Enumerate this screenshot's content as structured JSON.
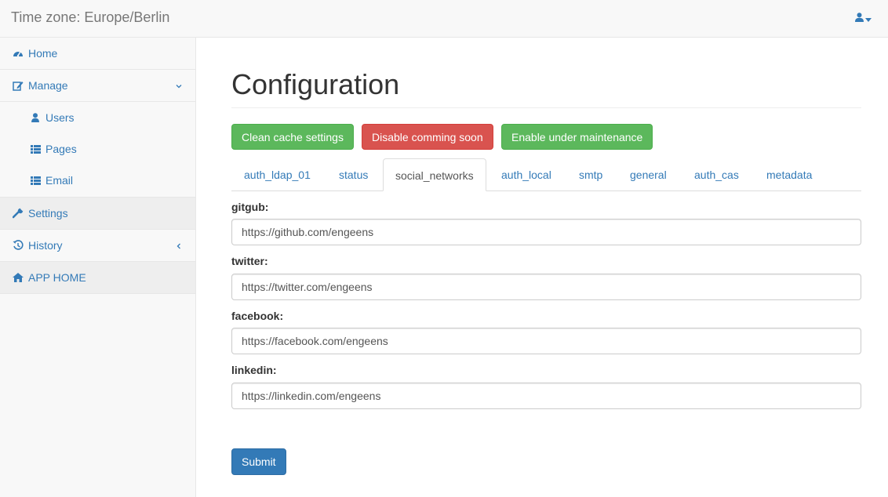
{
  "navbar": {
    "title": "Time zone: Europe/Berlin",
    "user_icon": "user-icon"
  },
  "sidebar": {
    "items": [
      {
        "label": "Home",
        "icon": "dashboard-icon"
      },
      {
        "label": "Manage",
        "icon": "edit-icon",
        "expanded": true,
        "children": [
          {
            "label": "Users",
            "icon": "user-icon"
          },
          {
            "label": "Pages",
            "icon": "list-icon"
          },
          {
            "label": "Email",
            "icon": "list-icon"
          }
        ]
      },
      {
        "label": "Settings",
        "icon": "wrench-icon",
        "active": true
      },
      {
        "label": "History",
        "icon": "history-icon"
      },
      {
        "label": "APP HOME",
        "icon": "home-icon",
        "active": true
      }
    ]
  },
  "main": {
    "title": "Configuration",
    "actions": {
      "clean_cache": "Clean cache settings",
      "disable_coming_soon": "Disable comming soon",
      "enable_maintenance": "Enable under maintenance"
    },
    "tabs": [
      {
        "label": "auth_ldap_01"
      },
      {
        "label": "status"
      },
      {
        "label": "social_networks",
        "active": true
      },
      {
        "label": "auth_local"
      },
      {
        "label": "smtp"
      },
      {
        "label": "general"
      },
      {
        "label": "auth_cas"
      },
      {
        "label": "metadata"
      }
    ],
    "fields": [
      {
        "label": "gitgub:",
        "value": "https://github.com/engeens"
      },
      {
        "label": "twitter:",
        "value": "https://twitter.com/engeens"
      },
      {
        "label": "facebook:",
        "value": "https://facebook.com/engeens"
      },
      {
        "label": "linkedin:",
        "value": "https://linkedin.com/engeens"
      }
    ],
    "submit_label": "Submit"
  },
  "colors": {
    "link": "#337ab7",
    "success": "#5cb85c",
    "danger": "#d9534f",
    "primary": "#337ab7"
  }
}
